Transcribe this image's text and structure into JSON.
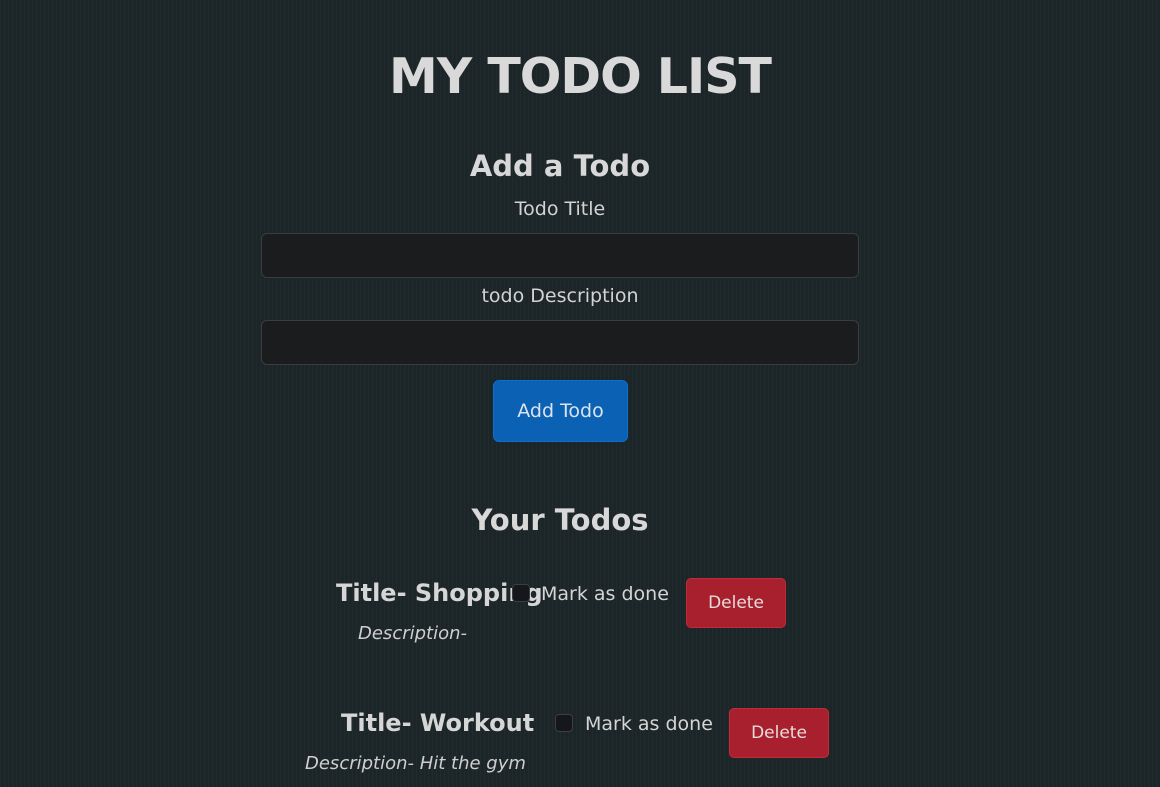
{
  "page": {
    "title": "MY TODO LIST"
  },
  "add_form": {
    "heading": "Add a Todo",
    "title_label": "Todo Title",
    "title_value": "",
    "description_label": "todo Description",
    "description_value": "",
    "submit_label": "Add Todo"
  },
  "todos_section": {
    "heading": "Your Todos",
    "items": [
      {
        "title": "Title- Shopping",
        "description": "Description-",
        "done_label": "Mark as done",
        "done": false,
        "delete_label": "Delete"
      },
      {
        "title": "Title- Workout",
        "description": "Description- Hit the gym",
        "done_label": "Mark as done",
        "done": false,
        "delete_label": "Delete"
      }
    ]
  },
  "colors": {
    "background": "#1c2527",
    "primary_button": "#0b61b3",
    "danger_button": "#a8202d",
    "input_background": "#1b1c1e"
  }
}
